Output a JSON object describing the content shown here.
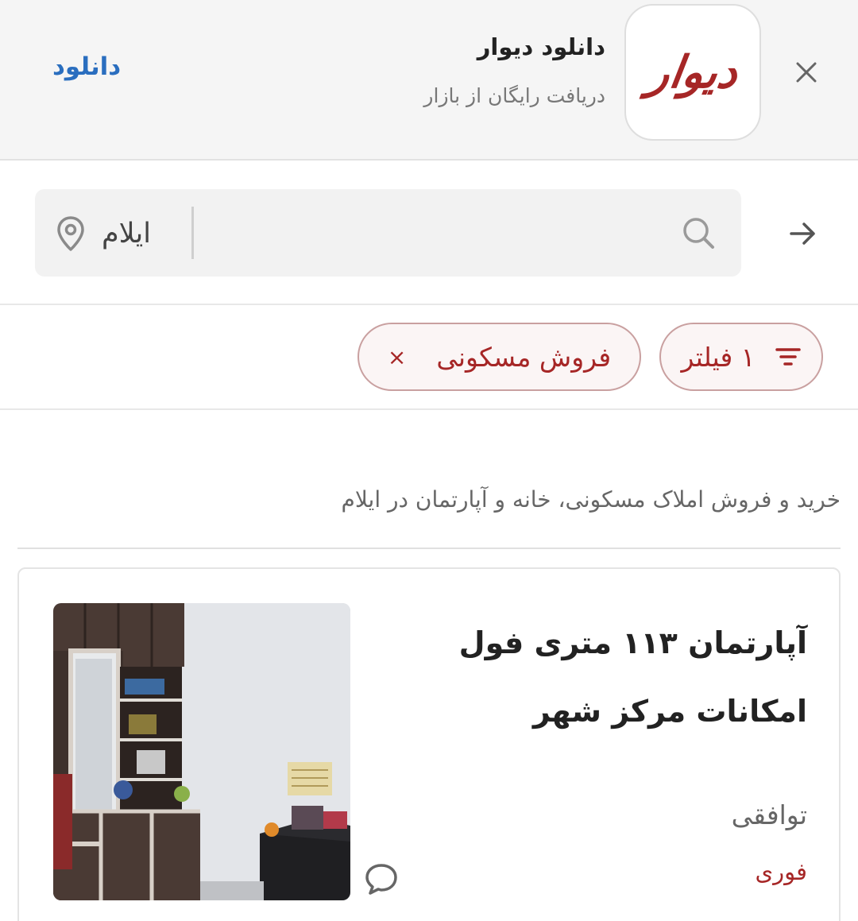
{
  "banner": {
    "logo_text": "دیوار",
    "title": "دانلود دیوار",
    "subtitle": "دریافت رایگان از بازار",
    "download_label": "دانلود"
  },
  "search": {
    "placeholder": "",
    "city": "ایلام"
  },
  "filters": {
    "filter_chip_label": "۱ فیلتر",
    "category_chip_label": "فروش مسکونی",
    "remove_symbol": "×"
  },
  "page": {
    "title": "خرید و فروش املاک مسکونی، خانه و آپارتمان در ایلام"
  },
  "listings": [
    {
      "title": "آپارتمان ۱۱۳ متری فول امکانات مرکز شهر",
      "price": "توافقی",
      "badge": "فوری"
    }
  ],
  "colors": {
    "brand": "#a62626",
    "download_link": "#2a6ebf",
    "chip_border": "#c9a0a0"
  },
  "icons": {
    "close": "close-icon",
    "back": "arrow-right-icon",
    "search": "search-icon",
    "location": "location-pin-icon",
    "filter": "filter-lines-icon",
    "chat": "chat-bubble-icon"
  }
}
